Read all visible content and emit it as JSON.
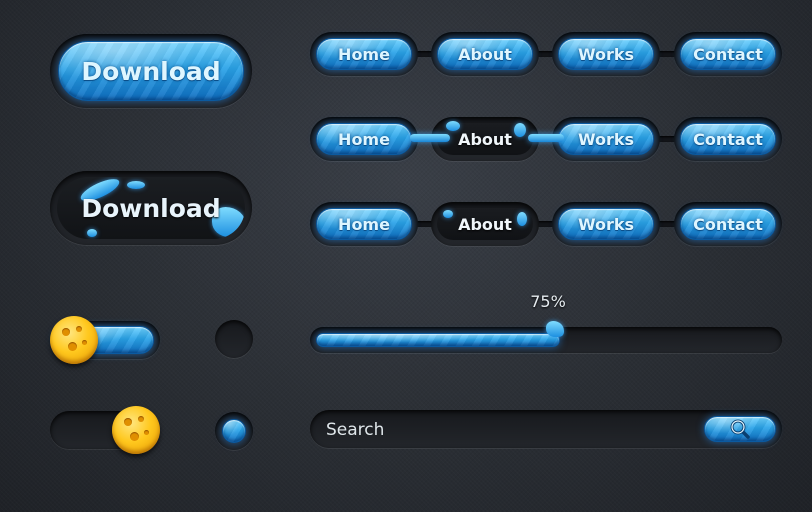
{
  "download": {
    "primary_label": "Download",
    "secondary_label": "Download"
  },
  "nav": {
    "rows": [
      {
        "state": "all-active",
        "items": [
          "Home",
          "About",
          "Works",
          "Contact"
        ]
      },
      {
        "state": "about-selected-splash",
        "items": [
          "Home",
          "About",
          "Works",
          "Contact"
        ]
      },
      {
        "state": "about-selected",
        "items": [
          "Home",
          "About",
          "Works",
          "Contact"
        ]
      }
    ]
  },
  "progress": {
    "label": "75%",
    "value": 0.53
  },
  "toggles": [
    {
      "state": "on"
    },
    {
      "state": "off"
    }
  ],
  "radios": [
    {
      "state": "unchecked"
    },
    {
      "state": "checked"
    }
  ],
  "search": {
    "placeholder": "Search",
    "button_icon": "search-icon"
  },
  "colors": {
    "accent": "#2aa3e8",
    "coin": "#ffc81e",
    "background": "#2a2e34"
  }
}
